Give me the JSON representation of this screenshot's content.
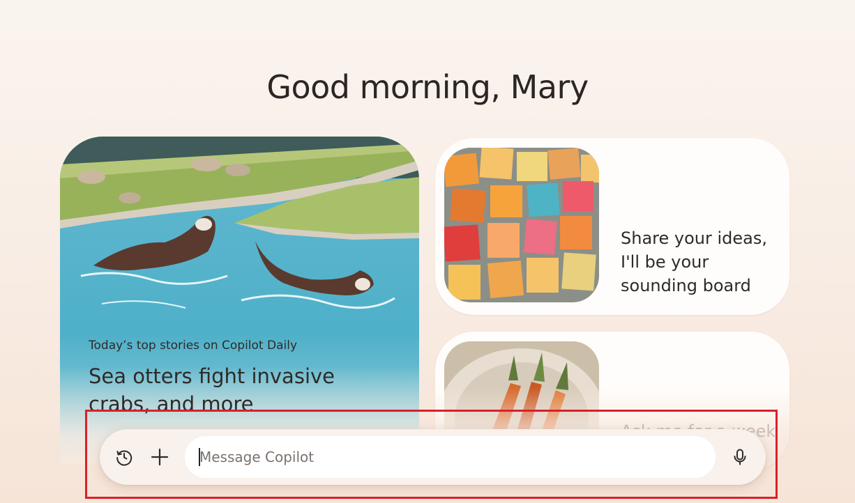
{
  "greeting": "Good morning, Mary",
  "daily_card": {
    "kicker": "Today’s top stories on Copilot Daily",
    "headline": "Sea otters fight invasive crabs, and more"
  },
  "ideas_card": {
    "text": "Share your ideas, I'll be your sounding board"
  },
  "cook_card": {
    "text": "Ask me for a week"
  },
  "composer": {
    "placeholder": "Message Copilot",
    "value": ""
  },
  "icons": {
    "history": "history-icon",
    "plus": "plus-icon",
    "mic": "microphone-icon"
  }
}
